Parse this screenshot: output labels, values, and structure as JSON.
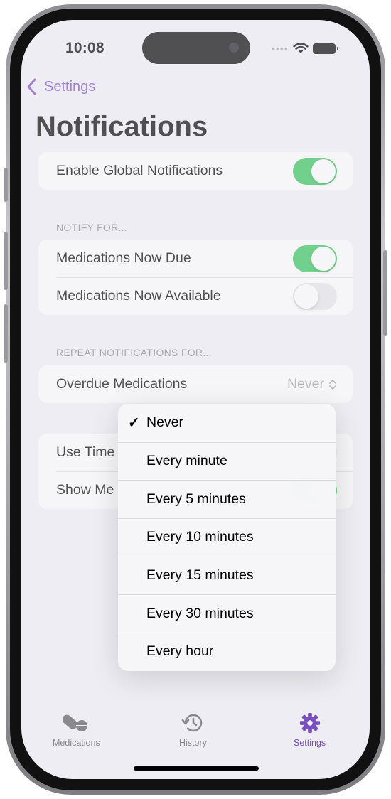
{
  "status_bar": {
    "time": "10:08",
    "signal_dots": "••••"
  },
  "nav": {
    "back_label": "Settings",
    "title": "Notifications"
  },
  "global": {
    "label": "Enable Global Notifications",
    "enabled": true
  },
  "notify_for": {
    "header": "NOTIFY FOR...",
    "items": [
      {
        "label": "Medications Now Due",
        "enabled": true
      },
      {
        "label": "Medications Now Available",
        "enabled": false
      }
    ]
  },
  "repeat": {
    "header": "REPEAT NOTIFICATIONS FOR...",
    "label": "Overdue Medications",
    "value": "Never"
  },
  "other_settings": {
    "items": [
      {
        "label": "Use Time"
      },
      {
        "label": "Show Me"
      }
    ]
  },
  "menu": {
    "selected": "Never",
    "options": [
      "Never",
      "Every minute",
      "Every 5 minutes",
      "Every 10 minutes",
      "Every 15 minutes",
      "Every 30 minutes",
      "Every hour"
    ]
  },
  "tabs": [
    {
      "label": "Medications",
      "icon": "pills-icon",
      "active": false
    },
    {
      "label": "History",
      "icon": "history-icon",
      "active": false
    },
    {
      "label": "Settings",
      "icon": "gear-icon",
      "active": true
    }
  ],
  "colors": {
    "accent": "#7a4fc0",
    "toggle_on": "#34c759",
    "toggle_off": "#e9e9eb",
    "background": "#f2f2f7"
  }
}
